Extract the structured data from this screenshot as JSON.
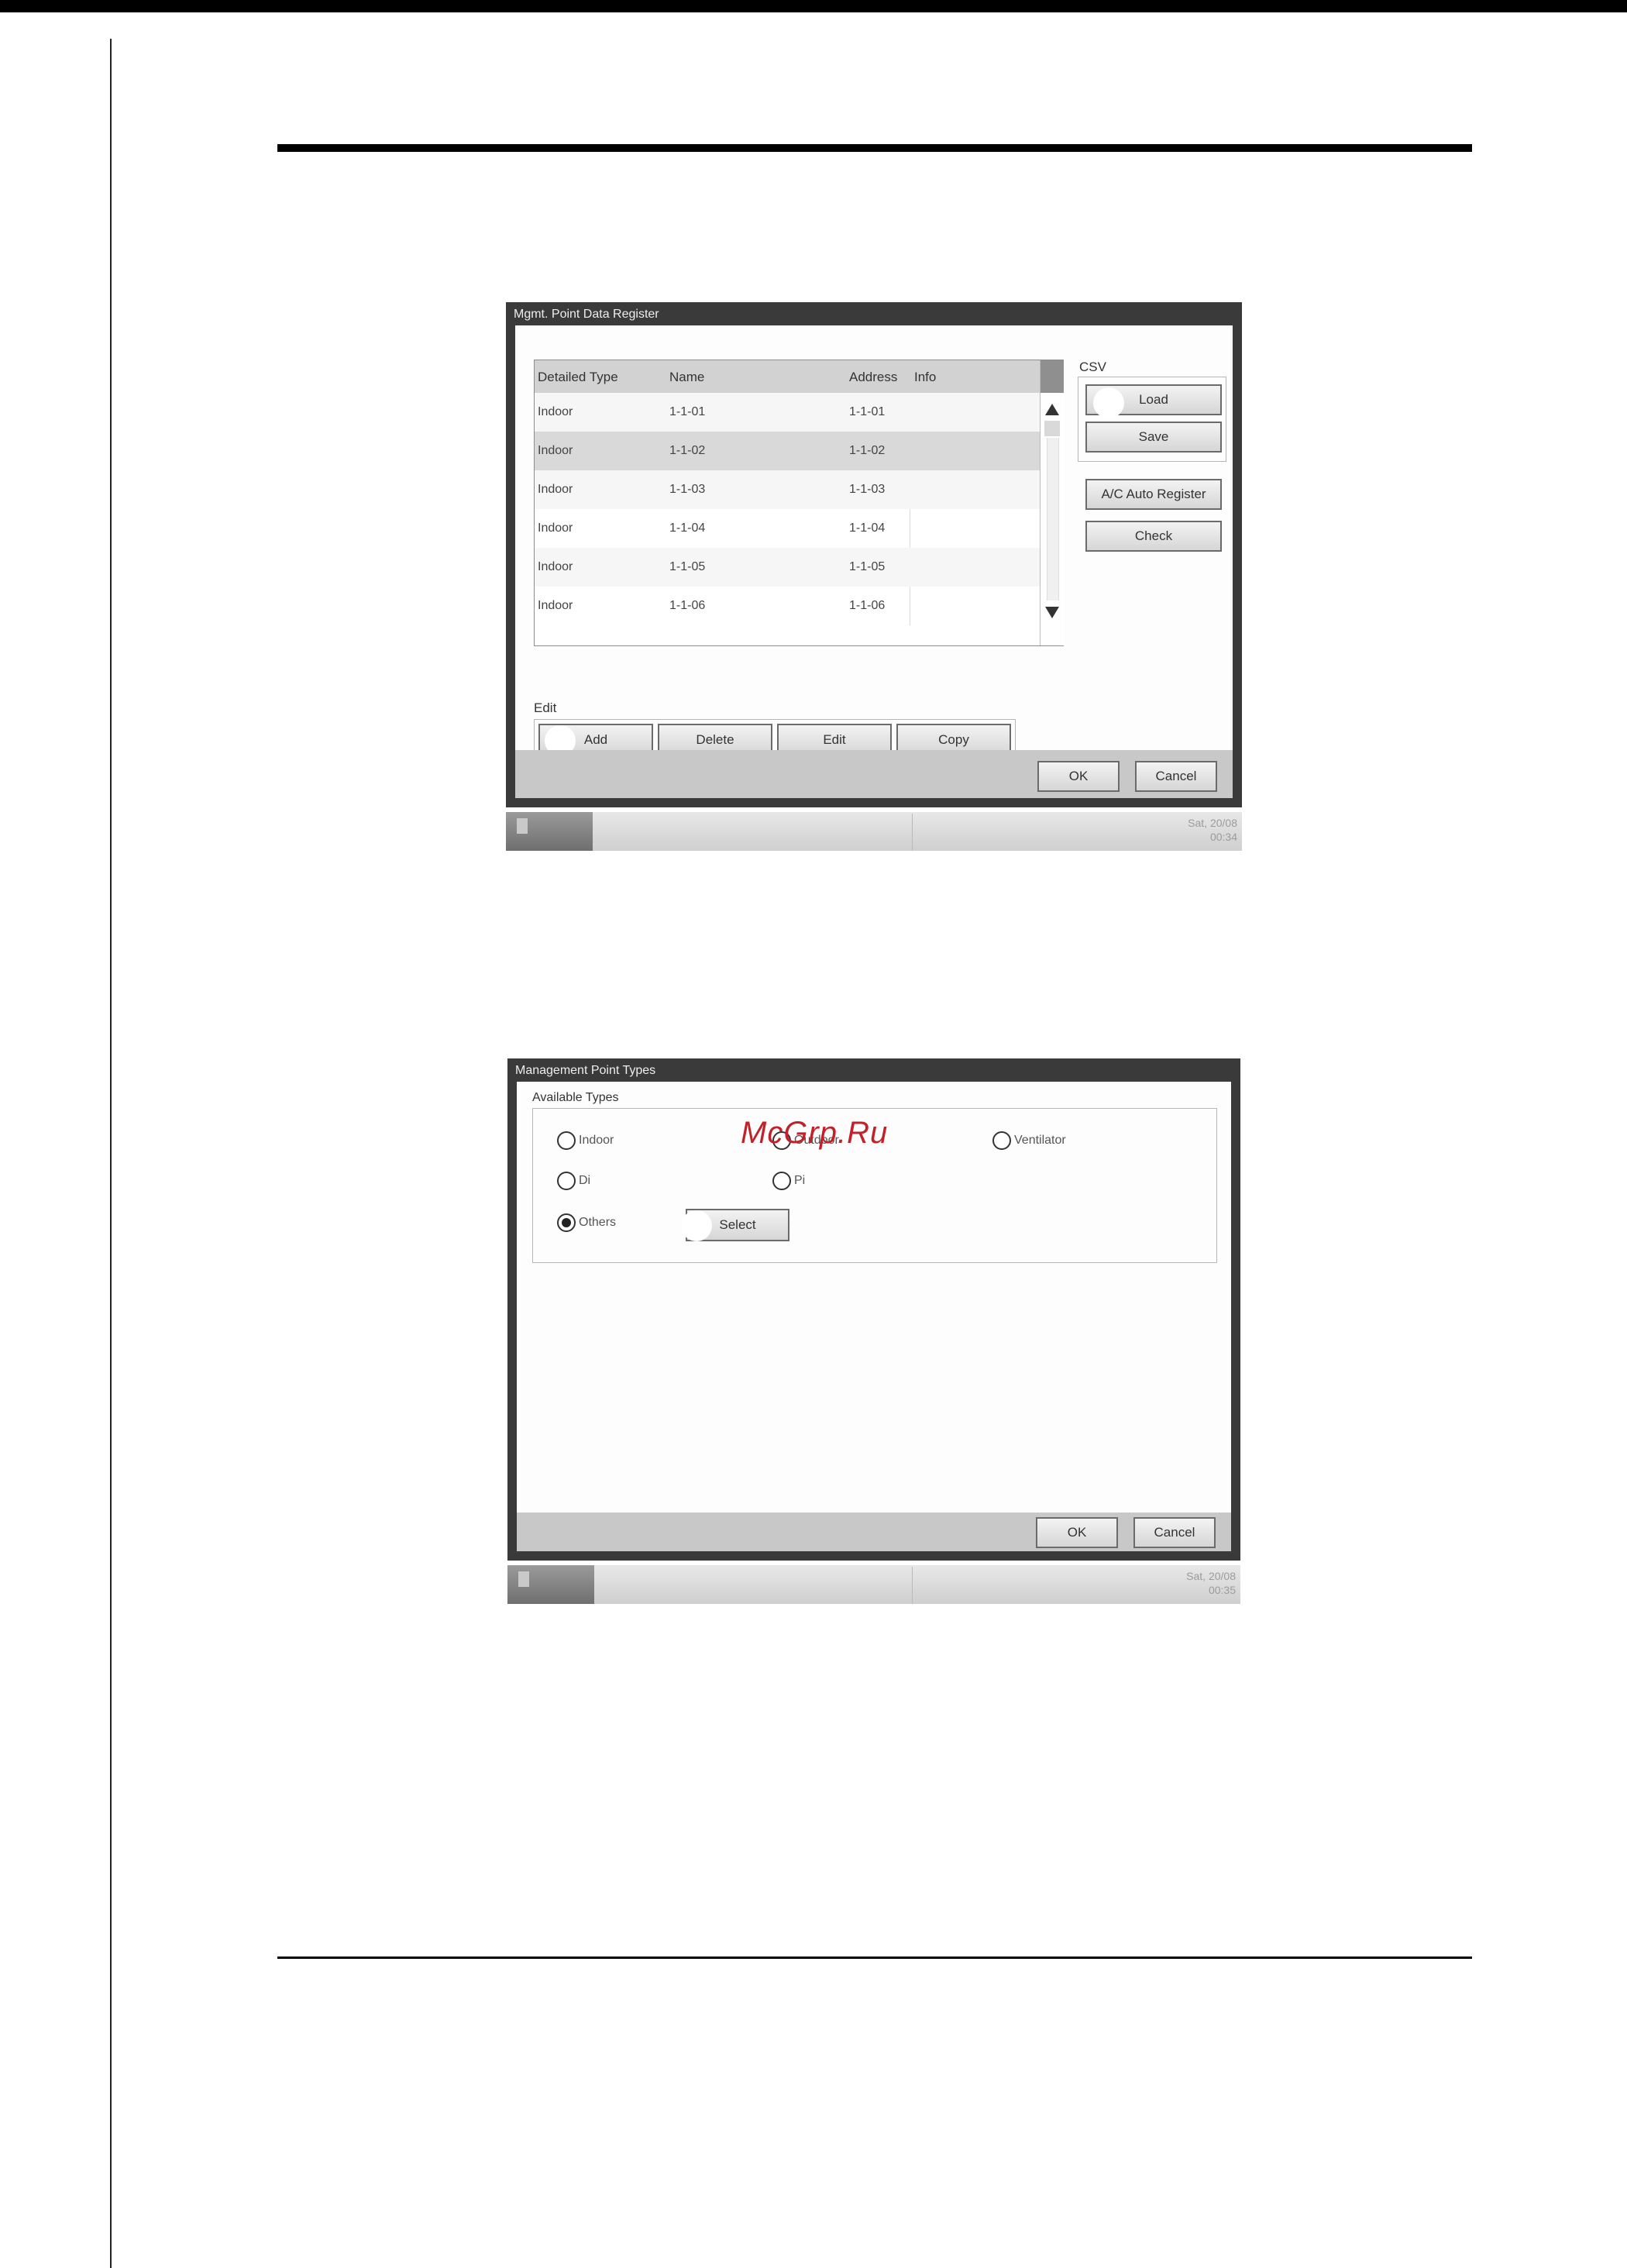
{
  "watermark": "McGrp.Ru",
  "screen1": {
    "title": "Mgmt. Point Data Register",
    "table": {
      "headers": [
        "Detailed Type",
        "Name",
        "Address",
        "Info"
      ],
      "rows": [
        {
          "type": "Indoor",
          "name": "1-1-01",
          "address": "1-1-01",
          "info": ""
        },
        {
          "type": "Indoor",
          "name": "1-1-02",
          "address": "1-1-02",
          "info": ""
        },
        {
          "type": "Indoor",
          "name": "1-1-03",
          "address": "1-1-03",
          "info": ""
        },
        {
          "type": "Indoor",
          "name": "1-1-04",
          "address": "1-1-04",
          "info": ""
        },
        {
          "type": "Indoor",
          "name": "1-1-05",
          "address": "1-1-05",
          "info": ""
        },
        {
          "type": "Indoor",
          "name": "1-1-06",
          "address": "1-1-06",
          "info": ""
        }
      ],
      "selected_row": 1
    },
    "csv": {
      "label": "CSV",
      "load": "Load",
      "save": "Save"
    },
    "ac_auto_register": "A/C Auto Register",
    "check": "Check",
    "edit": {
      "label": "Edit",
      "add": "Add",
      "delete": "Delete",
      "edit": "Edit",
      "copy": "Copy"
    },
    "ok": "OK",
    "cancel": "Cancel",
    "date": "Sat, 20/08",
    "time": "00:34"
  },
  "screen2": {
    "title": "Management Point Types",
    "available_types_label": "Available Types",
    "options": [
      {
        "label": "Indoor",
        "selected": false
      },
      {
        "label": "Outdoor",
        "selected": false
      },
      {
        "label": "Ventilator",
        "selected": false
      },
      {
        "label": "Di",
        "selected": false
      },
      {
        "label": "Pi",
        "selected": false
      },
      {
        "label": "Others",
        "selected": true
      }
    ],
    "select": "Select",
    "ok": "OK",
    "cancel": "Cancel",
    "date": "Sat, 20/08",
    "time": "00:35"
  }
}
